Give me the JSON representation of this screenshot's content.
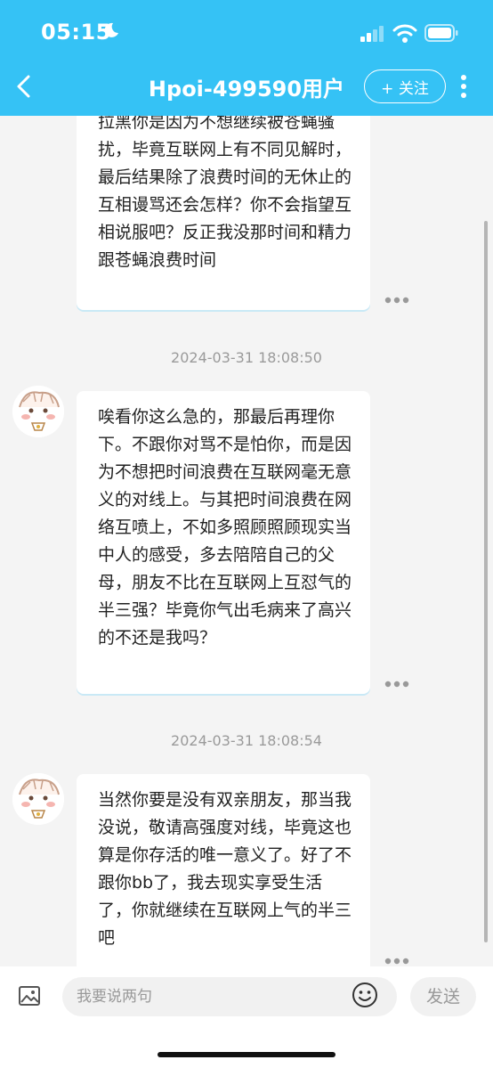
{
  "status_bar": {
    "time": "05:15"
  },
  "header": {
    "title": "Hpoi-499590用户",
    "follow_label": "+ 关注"
  },
  "messages": [
    {
      "text": "拉黑你是因为不想继续被苍蝇骚扰，毕竟互联网上有不同见解时，最后结果除了浪费时间的无休止的互相谩骂还会怎样？你不会指望互相说服吧？反正我没那时间和精力跟苍蝇浪费时间"
    },
    {
      "timestamp": "2024-03-31 18:08:50",
      "text": "唉看你这么急的，那最后再理你下。不跟你对骂不是怕你，而是因为不想把时间浪费在互联网毫无意义的对线上。与其把时间浪费在网络互喷上，不如多照顾照顾现实当中人的感受，多去陪陪自己的父母，朋友不比在互联网上互怼气的半三强？毕竟你气出毛病来了高兴的不还是我吗？"
    },
    {
      "timestamp": "2024-03-31 18:08:54",
      "text": "当然你要是没有双亲朋友，那当我没说，敬请高强度对线，毕竟这也算是你存活的唯一意义了。好了不跟你bb了，我去现实享受生活了，你就继续在互联网上气的半三吧"
    }
  ],
  "composer": {
    "placeholder": "我要说两句",
    "send_label": "发送"
  }
}
